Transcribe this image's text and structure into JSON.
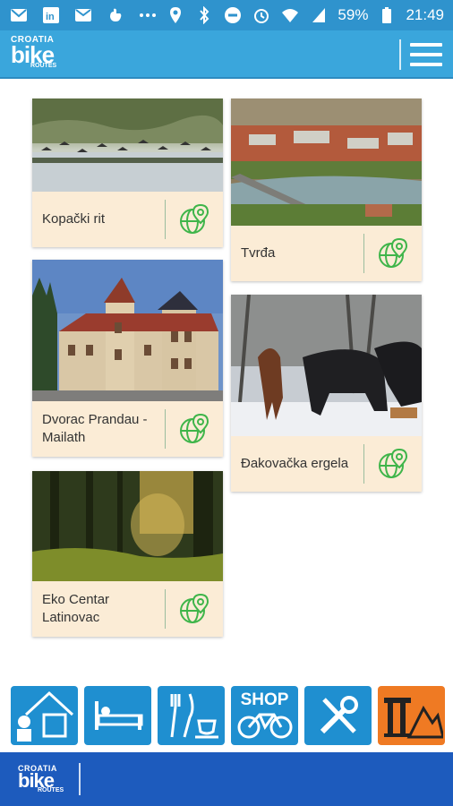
{
  "status": {
    "battery": "59%",
    "time": "21:49",
    "left_icons": [
      "email-icon",
      "linkedin-icon",
      "gmail-icon",
      "hand-icon",
      "more-icon"
    ],
    "right_icons": [
      "location-icon",
      "bluetooth-icon",
      "dnd-icon",
      "alarm-icon",
      "wifi-icon",
      "signal-icon",
      "battery-icon"
    ]
  },
  "app": {
    "logo_line1": "CROATIA",
    "logo_line2": "bike",
    "logo_line3": "ROUTES",
    "menu_icon": "hamburger-icon"
  },
  "cards": [
    {
      "title": "Kopački rit",
      "icon": "map-pin-globe-icon"
    },
    {
      "title": "Tvrđa",
      "icon": "map-pin-globe-icon"
    },
    {
      "title": "Dvorac Prandau - Mailath",
      "icon": "map-pin-globe-icon"
    },
    {
      "title": "Đakovačka ergela",
      "icon": "map-pin-globe-icon"
    },
    {
      "title": "Eko Centar Latinovac",
      "icon": "map-pin-globe-icon"
    }
  ],
  "bottom_nav": [
    {
      "name": "farmhouse-icon",
      "color": "#1f8fd0"
    },
    {
      "name": "bed-icon",
      "color": "#1f8fd0"
    },
    {
      "name": "fork-knife-cup-icon",
      "color": "#1f8fd0"
    },
    {
      "name": "shop-bike-icon",
      "label": "SHOP",
      "color": "#1f8fd0"
    },
    {
      "name": "tools-icon",
      "color": "#1f8fd0"
    },
    {
      "name": "culture-mountain-icon",
      "color": "#ef7a23"
    }
  ],
  "colors": {
    "statusbar": "#2f93cd",
    "appbar": "#3aa6dc",
    "card_footer": "#fbecd6",
    "pin_green": "#3fb54a",
    "footer": "#1d5bbd"
  }
}
